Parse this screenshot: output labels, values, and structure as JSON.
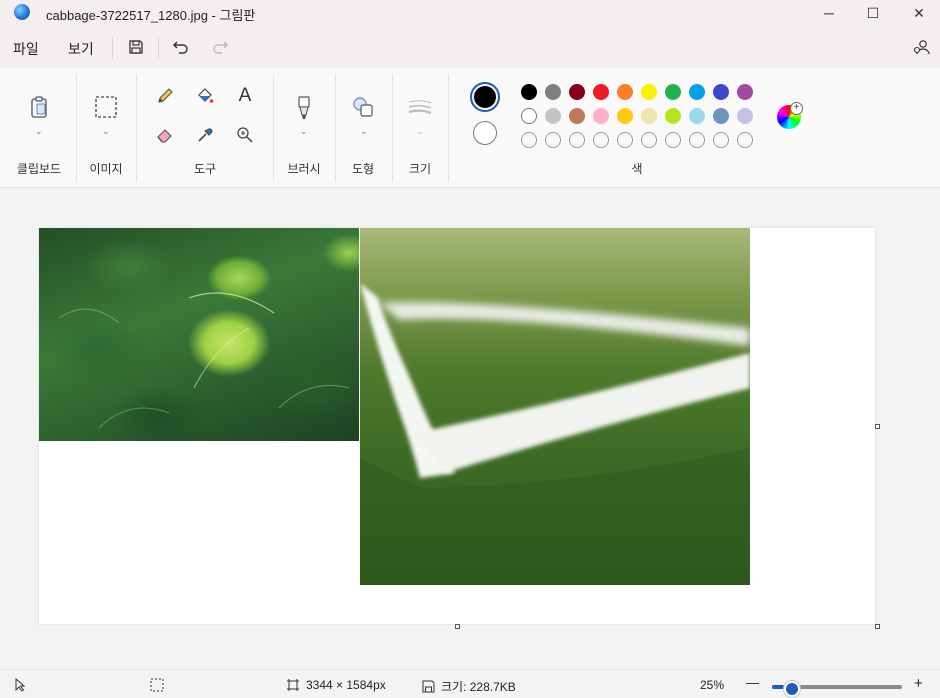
{
  "window": {
    "title": "cabbage-3722517_1280.jpg - 그림판",
    "minimize_glyph": "─",
    "maximize_glyph": "☐",
    "close_glyph": "✕"
  },
  "menu": {
    "file": "파일",
    "view": "보기"
  },
  "ribbon": {
    "groups": {
      "clipboard": "클립보드",
      "image": "이미지",
      "tools": "도구",
      "brushes": "브러시",
      "shapes": "도형",
      "size": "크기",
      "colors": "색"
    },
    "text_tool_glyph": "A",
    "primary_color": "#000000",
    "secondary_color": "#ffffff",
    "palette_row1": [
      "#000000",
      "#7f7f7f",
      "#880015",
      "#ed1c24",
      "#ff7f27",
      "#fff200",
      "#22b14c",
      "#00a2e8",
      "#3f48cc",
      "#a349a4"
    ],
    "palette_row2": [
      "#ffffff",
      "#c3c3c3",
      "#b97a57",
      "#ffaec9",
      "#ffc90e",
      "#efe4b0",
      "#b5e61d",
      "#99d9ea",
      "#7092be",
      "#c8bfe7"
    ]
  },
  "status": {
    "canvas_size": "3344 × 1584px",
    "file_size": "크기: 228.7KB",
    "zoom": "25%",
    "zoom_level_fraction": 0.15,
    "zoom_minus": "—",
    "zoom_plus": "+"
  }
}
